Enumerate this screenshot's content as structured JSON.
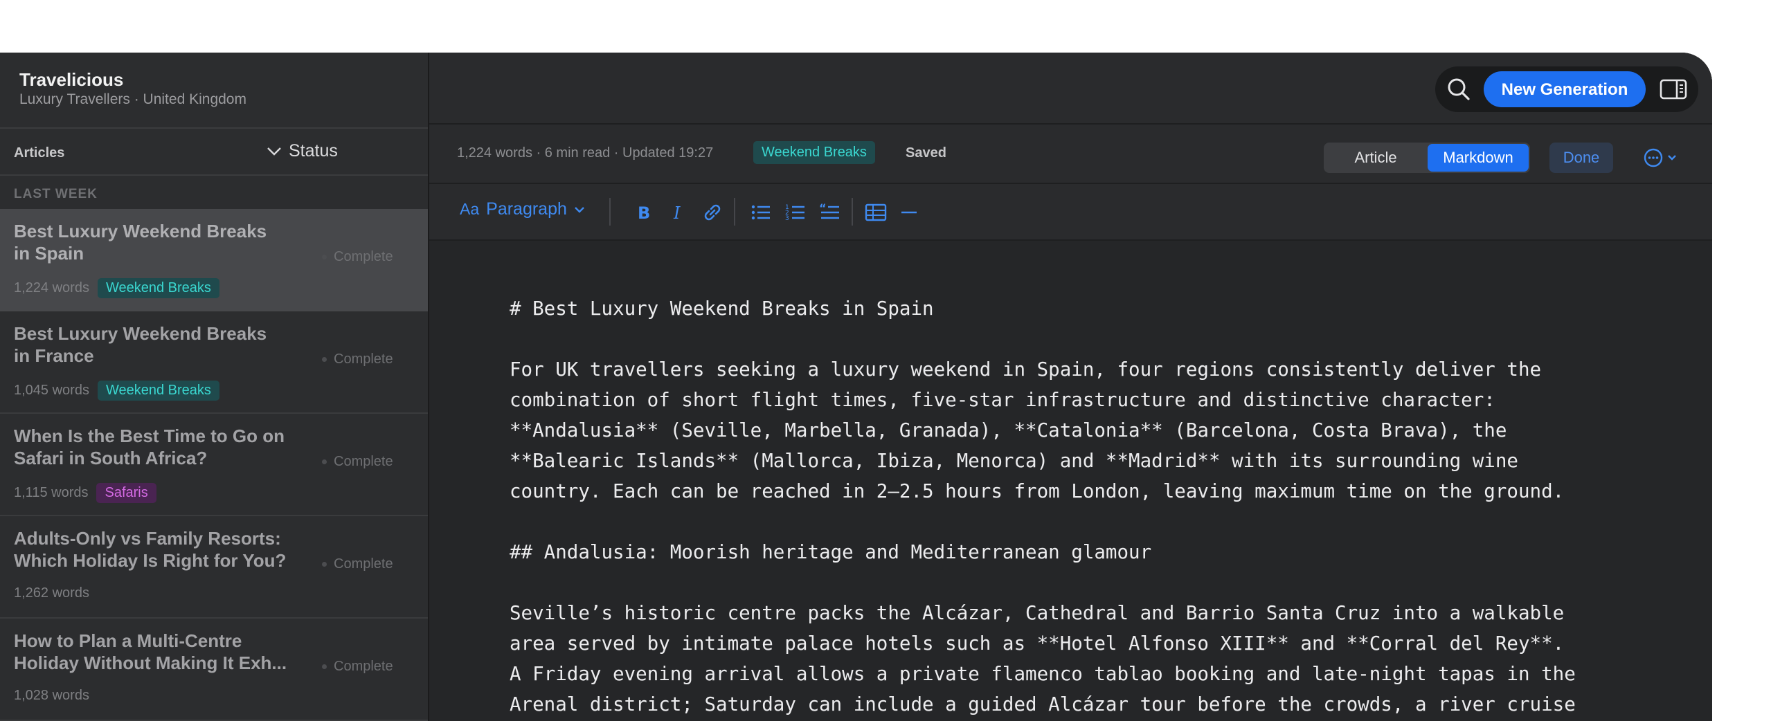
{
  "workspace": {
    "title": "Travelicious",
    "subtitle": "Luxury Travellers · United Kingdom"
  },
  "list_header": {
    "articles_label": "Articles",
    "status_label": "Status"
  },
  "section_label": "LAST WEEK",
  "articles": [
    {
      "title": "Best Luxury Weekend Breaks\nin Spain",
      "words": "1,224 words",
      "tag": "Weekend Breaks",
      "status": "Complete",
      "selected": true
    },
    {
      "title": "Best Luxury Weekend Breaks\nin France",
      "words": "1,045 words",
      "tag": "Weekend Breaks",
      "status": "Complete"
    },
    {
      "title": "When Is the Best Time to Go on\nSafari in South Africa?",
      "words": "1,115 words",
      "tag": "Safaris",
      "status": "Complete"
    },
    {
      "title": "Adults-Only vs Family Resorts:\nWhich Holiday Is Right for You?",
      "words": "1,262 words",
      "tag": "",
      "status": "Complete"
    },
    {
      "title": "How to Plan a Multi-Centre\nHoliday Without Making It Exh...",
      "words": "1,028 words",
      "tag": "",
      "status": "Complete"
    }
  ],
  "topbar": {
    "new_generation_label": "New Generation"
  },
  "infobar": {
    "meta": "1,224 words · 6 min read · Updated 19:27",
    "tag": "Weekend Breaks",
    "saved": "Saved",
    "view_article": "Article",
    "view_markdown": "Markdown",
    "done": "Done"
  },
  "toolbar": {
    "aa": "Aa",
    "paragraph": "Paragraph"
  },
  "editor": {
    "paragraphs": [
      "# Best Luxury Weekend Breaks in Spain",
      "For UK travellers seeking a luxury weekend in Spain, four regions consistently deliver the\ncombination of short flight times, five-star infrastructure and distinctive character:\n**Andalusia** (Seville, Marbella, Granada), **Catalonia** (Barcelona, Costa Brava), the\n**Balearic Islands** (Mallorca, Ibiza, Menorca) and **Madrid** with its surrounding wine\ncountry. Each can be reached in 2–2.5 hours from London, leaving maximum time on the ground.",
      "## Andalusia: Moorish heritage and Mediterranean glamour",
      "Seville’s historic centre packs the Alcázar, Cathedral and Barrio Santa Cruz into a walkable\narea served by intimate palace hotels such as **Hotel Alfonso XIII** and **Corral del Rey**.\nA Friday evening arrival allows a private flamenco tablao booking and late-night tapas in the\nArenal district; Saturday can include a guided Alcázar tour before the crowds, a river cruise"
    ]
  },
  "colors": {
    "accent": "#1e6ff0",
    "tag_teal_bg": "#1f4a4d",
    "tag_teal_fg": "#3ad7d0",
    "tag_purple_bg": "#4a2452",
    "tag_purple_fg": "#d46ae3"
  },
  "icons": [
    "search-icon",
    "sidebar-panel-icon",
    "chevron-down-icon",
    "more-options-icon",
    "bold-icon",
    "italic-icon",
    "link-icon",
    "bullet-list-icon",
    "numbered-list-icon",
    "quote-icon",
    "table-icon",
    "divider-icon"
  ]
}
